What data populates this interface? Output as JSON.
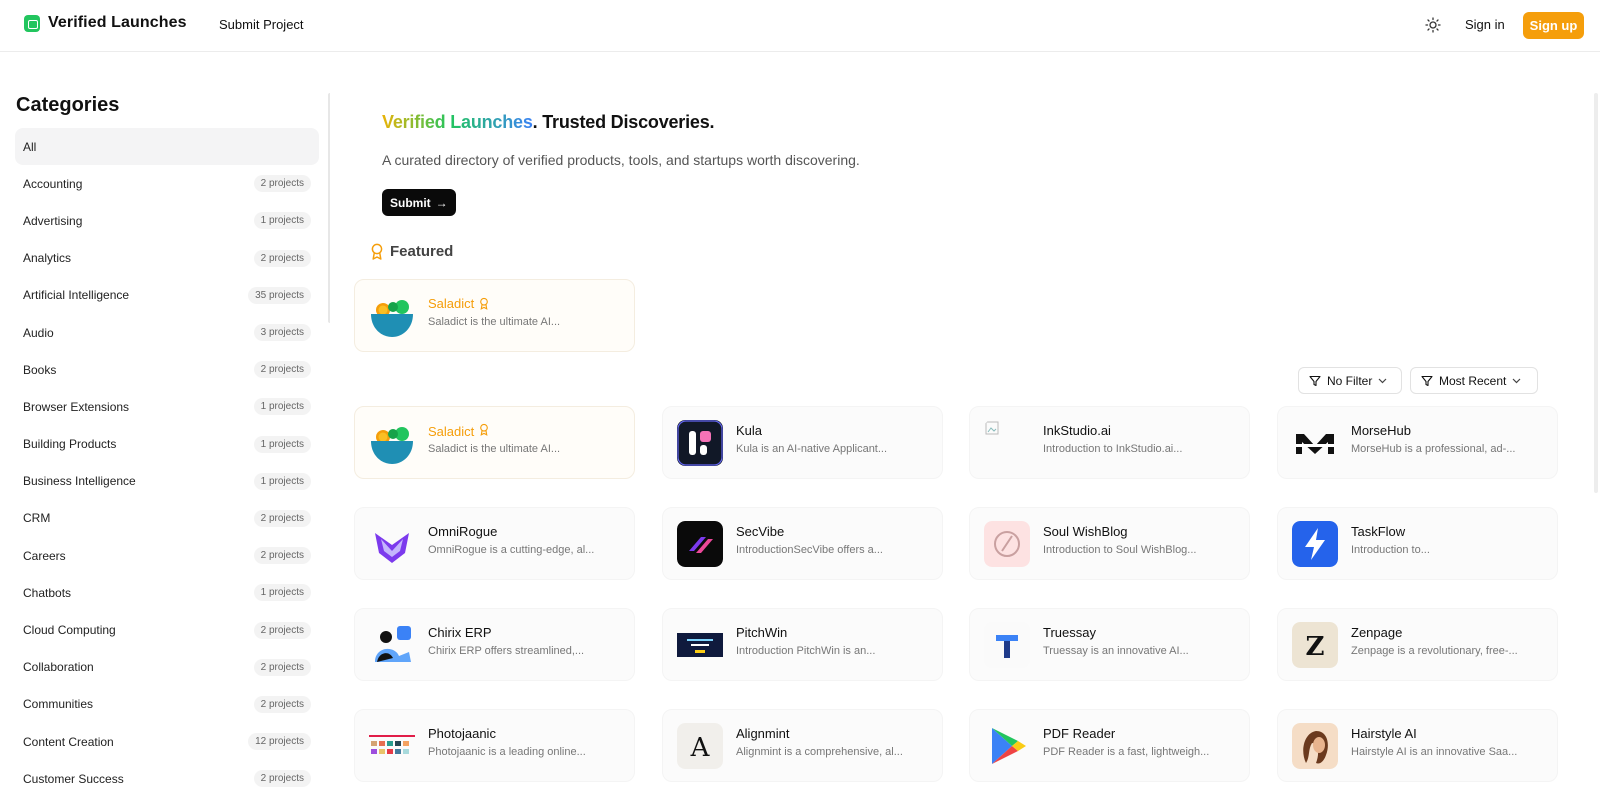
{
  "header": {
    "brand": "Verified Launches",
    "nav_submit": "Submit Project",
    "signin": "Sign in",
    "signup": "Sign up"
  },
  "sidebar": {
    "title": "Categories",
    "items": [
      {
        "label": "All",
        "count": ""
      },
      {
        "label": "Accounting",
        "count": "2 projects"
      },
      {
        "label": "Advertising",
        "count": "1 projects"
      },
      {
        "label": "Analytics",
        "count": "2 projects"
      },
      {
        "label": "Artificial Intelligence",
        "count": "35 projects"
      },
      {
        "label": "Audio",
        "count": "3 projects"
      },
      {
        "label": "Books",
        "count": "2 projects"
      },
      {
        "label": "Browser Extensions",
        "count": "1 projects"
      },
      {
        "label": "Building Products",
        "count": "1 projects"
      },
      {
        "label": "Business Intelligence",
        "count": "1 projects"
      },
      {
        "label": "CRM",
        "count": "2 projects"
      },
      {
        "label": "Careers",
        "count": "2 projects"
      },
      {
        "label": "Chatbots",
        "count": "1 projects"
      },
      {
        "label": "Cloud Computing",
        "count": "2 projects"
      },
      {
        "label": "Collaboration",
        "count": "2 projects"
      },
      {
        "label": "Communities",
        "count": "2 projects"
      },
      {
        "label": "Content Creation",
        "count": "12 projects"
      },
      {
        "label": "Customer Success",
        "count": "2 projects"
      }
    ]
  },
  "hero": {
    "title_gradient": "Verified Launches",
    "title_rest": ". Trusted Discoveries.",
    "subtitle": "A curated directory of verified products, tools, and startups worth discovering.",
    "submit_label": "Submit",
    "submit_arrow": "→"
  },
  "featured": {
    "heading": "Featured",
    "card": {
      "name": "Saladict",
      "desc": "Saladict is the ultimate AI...",
      "logo": "salad-bowl-icon"
    }
  },
  "filters": {
    "filter_label": "No Filter",
    "sort_label": "Most Recent"
  },
  "projects": [
    {
      "name": "Saladict",
      "desc": "Saladict is the ultimate AI...",
      "logo": "salad-bowl-icon",
      "featured": true
    },
    {
      "name": "Kula",
      "desc": "Kula is an AI-native Applicant...",
      "logo": "kula-logo"
    },
    {
      "name": "InkStudio.ai",
      "desc": "Introduction to InkStudio.ai...",
      "logo": "broken-image-icon"
    },
    {
      "name": "MorseHub",
      "desc": "MorseHub is a professional, ad-...",
      "logo": "morsehub-logo"
    },
    {
      "name": "OmniRogue",
      "desc": "OmniRogue is a cutting-edge, al...",
      "logo": "omnirogue-logo"
    },
    {
      "name": "SecVibe",
      "desc": "IntroductionSecVibe offers a...",
      "logo": "secvibe-logo"
    },
    {
      "name": "Soul WishBlog",
      "desc": "Introduction to Soul WishBlog...",
      "logo": "soulwishblog-logo"
    },
    {
      "name": "TaskFlow",
      "desc": "Introduction to...",
      "logo": "lightning-icon"
    },
    {
      "name": "Chirix ERP",
      "desc": "Chirix ERP offers streamlined,...",
      "logo": "chirix-logo"
    },
    {
      "name": "PitchWin",
      "desc": "Introduction PitchWin is an...",
      "logo": "pitchwin-logo"
    },
    {
      "name": "Truessay",
      "desc": "Truessay is an innovative AI...",
      "logo": "truessay-logo"
    },
    {
      "name": "Zenpage",
      "desc": "Zenpage is a revolutionary, free-...",
      "logo": "zenpage-logo"
    },
    {
      "name": "Photojaanic",
      "desc": "Photojaanic is a leading online...",
      "logo": "photojaanic-logo"
    },
    {
      "name": "Alignmint",
      "desc": "Alignmint is a comprehensive, al...",
      "logo": "alignmint-logo"
    },
    {
      "name": "PDF Reader",
      "desc": "PDF Reader is a fast, lightweigh...",
      "logo": "play-store-icon"
    },
    {
      "name": "Hairstyle AI",
      "desc": "Hairstyle AI is an innovative Saa...",
      "logo": "hairstyle-logo"
    }
  ],
  "colors": {
    "accent": "#f59e0b",
    "brand": "#22c55e",
    "dark": "#0a0a0a"
  }
}
